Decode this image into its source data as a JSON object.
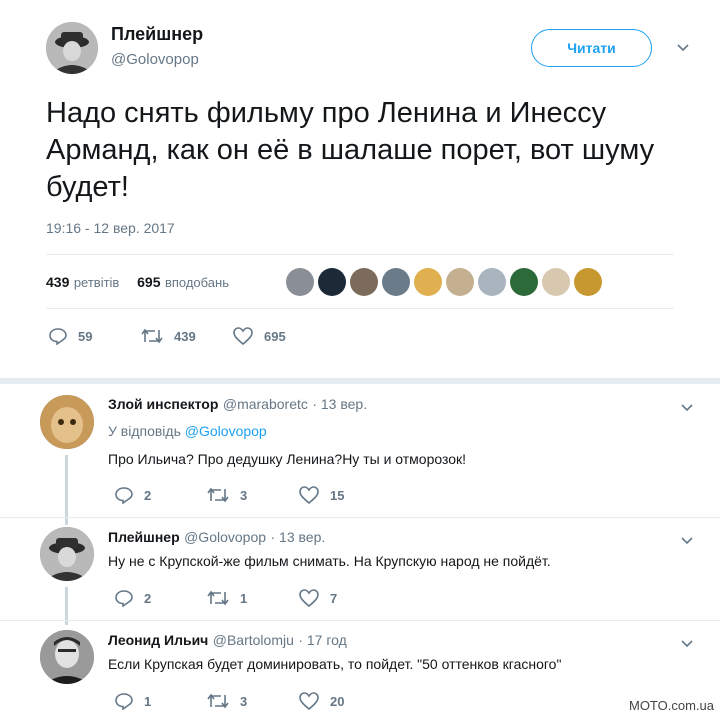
{
  "main_tweet": {
    "author_name": "Плейшнер",
    "author_handle": "@Golovopop",
    "follow_label": "Читати",
    "text": "Надо снять фильму про Ленина и Инессу Арманд, как он её в шалаше порет, вот шуму будет!",
    "timestamp": "19:16 - 12 вер. 2017",
    "retweets_count": "439",
    "retweets_label": "ретвітів",
    "likes_count": "695",
    "likes_label": "вподобань",
    "actions": {
      "replies": "59",
      "retweets": "439",
      "likes": "695"
    }
  },
  "replies": [
    {
      "author_name": "Злой инспектор",
      "author_handle": "@maraboretc",
      "time": "· 13 вер.",
      "replying_to_prefix": "У відповідь",
      "replying_to_handle": "@Golovopop",
      "text": "Про Ильича? Про дедушку Ленина?Ну ты и отморозок!",
      "actions": {
        "replies": "2",
        "retweets": "3",
        "likes": "15"
      }
    },
    {
      "author_name": "Плейшнер",
      "author_handle": "@Golovopop",
      "time": "· 13 вер.",
      "text": "Ну не с Крупской-же фильм снимать. На Крупскую народ не пойдёт.",
      "actions": {
        "replies": "2",
        "retweets": "1",
        "likes": "7"
      }
    },
    {
      "author_name": "Леонид Ильич",
      "author_handle": "@Bartolomju",
      "time": "· 17 год",
      "text": "Если Крупская будет доминировать, то пойдет. \"50 оттенков кгасного\"",
      "actions": {
        "replies": "1",
        "retweets": "3",
        "likes": "20"
      }
    }
  ],
  "watermark": "MOTO.com.ua",
  "colors": {
    "accent": "#1da1f2",
    "muted": "#657786",
    "divider": "#e6ecf0"
  }
}
